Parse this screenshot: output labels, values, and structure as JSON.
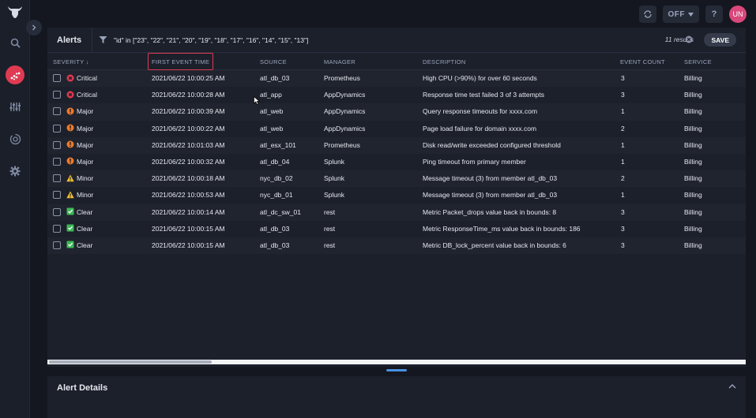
{
  "topbar": {
    "refresh_icon": "refresh-icon",
    "toggle_label": "OFF",
    "help_label": "?",
    "avatar_initials": "UN"
  },
  "sidebar": {
    "logo": "bull-logo-icon",
    "items": [
      {
        "icon": "search-icon"
      },
      {
        "icon": "alerts-chart-icon",
        "active": true
      },
      {
        "icon": "sliders-icon"
      },
      {
        "icon": "sync-icon"
      },
      {
        "icon": "gear-icon"
      }
    ]
  },
  "alerts": {
    "title": "Alerts",
    "filter_text": "\"id\" in [\"23\", \"22\", \"21\", \"20\", \"19\", \"18\", \"17\", \"16\", \"14\", \"15\", \"13\"]",
    "results": "11 results",
    "save_label": "SAVE",
    "columns": {
      "severity": "SEVERITY ↓",
      "first_event_time": "FIRST EVENT TIME",
      "source": "SOURCE",
      "manager": "MANAGER",
      "description": "DESCRIPTION",
      "event_count": "EVENT COUNT",
      "service": "SERVICE"
    },
    "rows": [
      {
        "severity": "Critical",
        "time": "2021/06/22 10:00:25 AM",
        "source": "atl_db_03",
        "manager": "Prometheus",
        "description": "High CPU (>90%) for over 60 seconds",
        "count": "3",
        "service": "Billing"
      },
      {
        "severity": "Critical",
        "time": "2021/06/22 10:00:28 AM",
        "source": "atl_app",
        "manager": "AppDynamics",
        "description": "Response time test failed 3 of 3 attempts",
        "count": "3",
        "service": "Billing"
      },
      {
        "severity": "Major",
        "time": "2021/06/22 10:00:39 AM",
        "source": "atl_web",
        "manager": "AppDynamics",
        "description": "Query response timeouts for xxxx.com",
        "count": "1",
        "service": "Billing"
      },
      {
        "severity": "Major",
        "time": "2021/06/22 10:00:22 AM",
        "source": "atl_web",
        "manager": "AppDynamics",
        "description": "Page load failure for domain xxxx.com",
        "count": "2",
        "service": "Billing"
      },
      {
        "severity": "Major",
        "time": "2021/06/22 10:01:03 AM",
        "source": "atl_esx_101",
        "manager": "Prometheus",
        "description": "Disk read/write exceeded configured threshold",
        "count": "1",
        "service": "Billing"
      },
      {
        "severity": "Major",
        "time": "2021/06/22 10:00:32 AM",
        "source": "atl_db_04",
        "manager": "Splunk",
        "description": "Ping timeout from primary member",
        "count": "1",
        "service": "Billing"
      },
      {
        "severity": "Minor",
        "time": "2021/06/22 10:00:18 AM",
        "source": "nyc_db_02",
        "manager": "Splunk",
        "description": "Message timeout (3) from member atl_db_03",
        "count": "2",
        "service": "Billing"
      },
      {
        "severity": "Minor",
        "time": "2021/06/22 10:00:53 AM",
        "source": "nyc_db_01",
        "manager": "Splunk",
        "description": "Message timeout (3) from member atl_db_03",
        "count": "1",
        "service": "Billing"
      },
      {
        "severity": "Clear",
        "time": "2021/06/22 10:00:14 AM",
        "source": "atl_dc_sw_01",
        "manager": "rest",
        "description": "Metric Packet_drops value back in bounds: 8",
        "count": "3",
        "service": "Billing"
      },
      {
        "severity": "Clear",
        "time": "2021/06/22 10:00:15 AM",
        "source": "atl_db_03",
        "manager": "rest",
        "description": "Metric ResponseTime_ms value back in bounds: 186",
        "count": "3",
        "service": "Billing"
      },
      {
        "severity": "Clear",
        "time": "2021/06/22 10:00:15 AM",
        "source": "atl_db_03",
        "manager": "rest",
        "description": "Metric DB_lock_percent value back in bounds: 6",
        "count": "3",
        "service": "Billing"
      }
    ]
  },
  "severity_colors": {
    "Critical": "#e03a52",
    "Major": "#f07a2a",
    "Minor": "#f2c029",
    "Clear": "#3db856"
  },
  "details": {
    "title": "Alert Details"
  }
}
